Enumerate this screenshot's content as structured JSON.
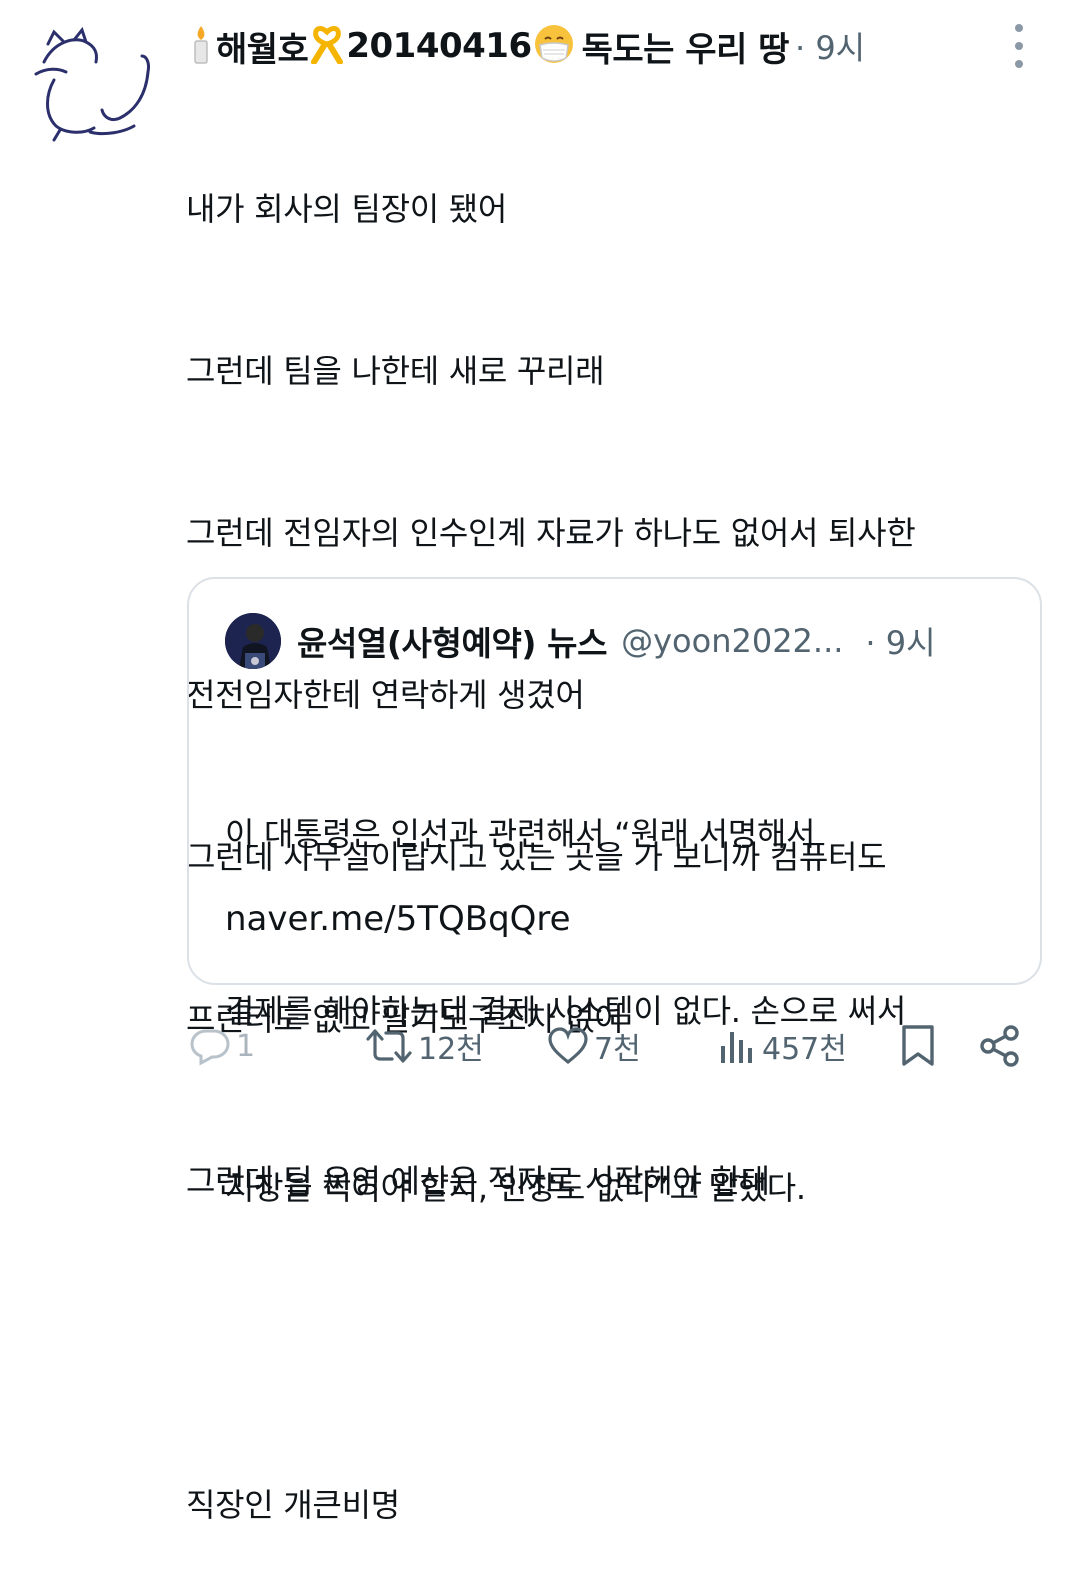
{
  "tweet": {
    "author_name": "해월호",
    "author_number": "20140416",
    "author_suffix": "독도는 우리 땅",
    "time": "· 9시",
    "lines": [
      "내가 회사의 팀장이 됐어",
      "그런데 팀을 나한테 새로 꾸리래",
      "그런데 전임자의 인수인계 자료가 하나도 없어서 퇴사한",
      "전전임자한테 연락하게 생겼어",
      "그런데 사무실이랍시고 있는 곳을 가 보니까 컴퓨터도",
      "프린터도 없고 필기도구조차 없어",
      "그런데 팀 운영 예산은 적자로 시작해야 한대",
      "",
      "직장인 개큰비명"
    ]
  },
  "quote": {
    "name": "윤석열(사형예약) 뉴스",
    "handle": "@yoon2022...",
    "time": "· 9시",
    "lines": [
      "이 대통령은 인선과 관련해서 “원래 서명해서",
      "결제를 해야하는데 결제 시스템이 없다. 손으로 써서",
      "지장을 찍어야 할지, 인장도 없다”고 말했다."
    ],
    "link": "naver.me/5TQBqQre"
  },
  "actions": {
    "reply_count": "1",
    "retweet_count": "12천",
    "like_count": "7천",
    "views_count": "457천"
  },
  "icons": {
    "avatar": "cat-drawing-icon",
    "candle": "candle-emoji-icon",
    "ribbon": "yellow-ribbon-emoji-icon",
    "mask": "face-mask-emoji-icon",
    "more": "more-options-icon",
    "reply": "reply-icon",
    "retweet": "retweet-icon",
    "like": "heart-icon",
    "views": "views-chart-icon",
    "bookmark": "bookmark-icon",
    "share": "share-icon"
  },
  "colors": {
    "text": "#0f1419",
    "secondary": "#536471",
    "border": "#dbe1e6",
    "ribbon": "#f5b400"
  }
}
